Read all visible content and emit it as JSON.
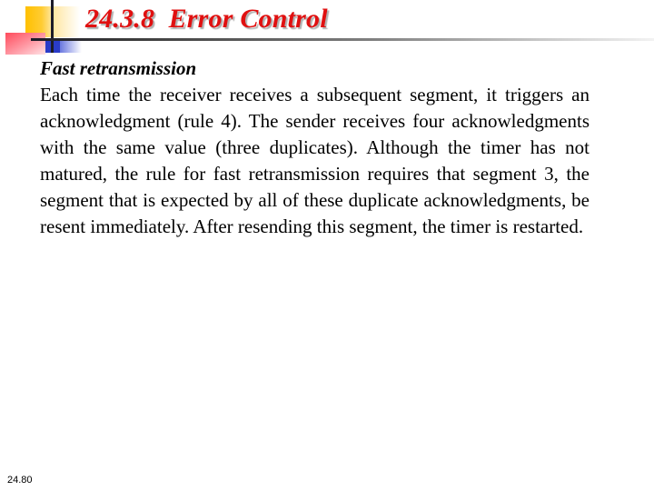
{
  "slide": {
    "title": "24.3.8  Error Control",
    "subheading": "Fast retransmission",
    "paragraph": "Each time the receiver receives a subsequent segment, it triggers an acknowledgment (rule 4). The sender receives four acknowledgments with the same value (three duplicates). Although the timer has not matured, the rule for fast retransmission  requires that segment 3, the segment that is expected by all of these duplicate acknowledgments, be resent immediately. After resending this segment, the timer is restarted.",
    "page_number": "24.80"
  },
  "colors": {
    "title": "#e01010",
    "deco_yellow": "#ffc000",
    "deco_red": "#ff4b5c",
    "deco_blue": "#2a3cc8",
    "text": "#000000"
  }
}
